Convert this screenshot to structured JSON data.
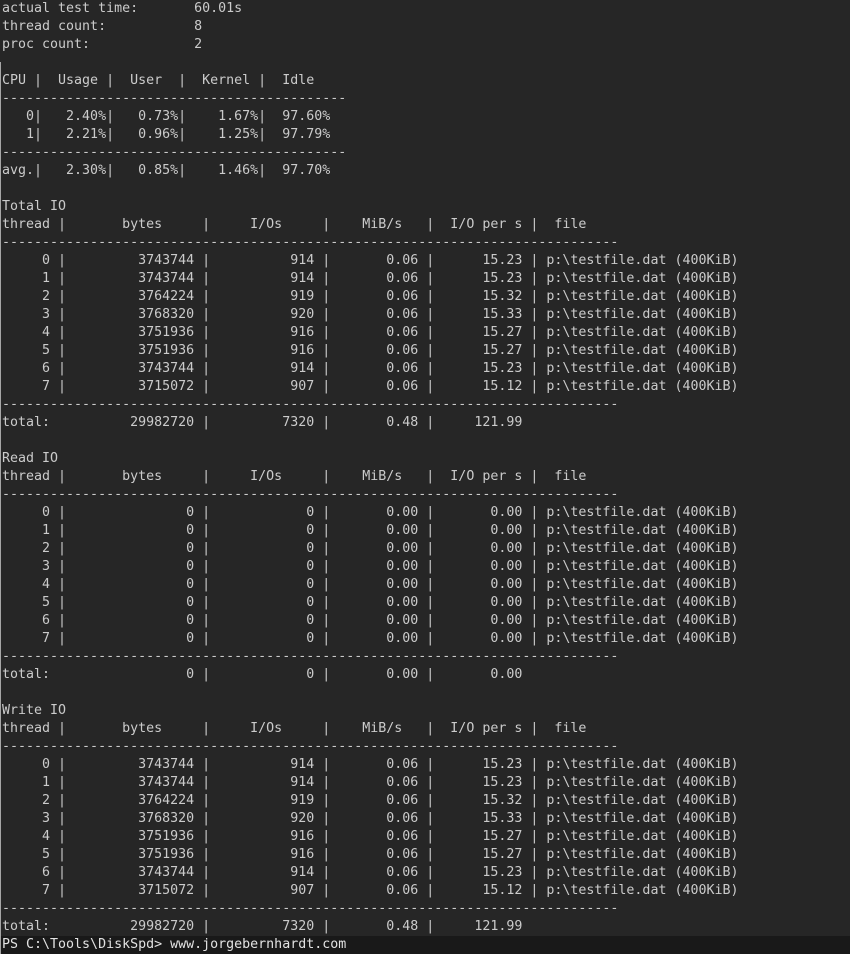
{
  "window": {
    "title": "Windows PowerShell - DiskSpd output"
  },
  "colors": {
    "background": "#262626",
    "foreground": "#cbcbcb",
    "prompt_line_background": "#191919",
    "prompt_foreground": "#e2e2e2",
    "window_edge": "#bdbdbd"
  },
  "summary": [
    {
      "label": "actual test time:",
      "value": "60.01s"
    },
    {
      "label": "thread count:",
      "value": "8"
    },
    {
      "label": "proc count:",
      "value": "2"
    }
  ],
  "cpu_table": {
    "header": "CPU |  Usage |  User  |  Kernel |  Idle",
    "separator_width": 43,
    "rows": [
      [
        "0",
        "2.40%",
        "0.73%",
        "1.67%",
        "97.60%"
      ],
      [
        "1",
        "2.21%",
        "0.96%",
        "1.25%",
        "97.79%"
      ]
    ],
    "avg_label": "avg.",
    "avg": [
      "2.30%",
      "0.85%",
      "1.46%",
      "97.70%"
    ]
  },
  "io_header": "thread |       bytes     |     I/Os     |    MiB/s   |  I/O per s |  file",
  "io_separator_width": 77,
  "file_label": "p:\\testfile.dat (400KiB)",
  "io_sections": [
    {
      "title": "Total IO",
      "rows": [
        [
          "0",
          "3743744",
          "914",
          "0.06",
          "15.23"
        ],
        [
          "1",
          "3743744",
          "914",
          "0.06",
          "15.23"
        ],
        [
          "2",
          "3764224",
          "919",
          "0.06",
          "15.32"
        ],
        [
          "3",
          "3768320",
          "920",
          "0.06",
          "15.33"
        ],
        [
          "4",
          "3751936",
          "916",
          "0.06",
          "15.27"
        ],
        [
          "5",
          "3751936",
          "916",
          "0.06",
          "15.27"
        ],
        [
          "6",
          "3743744",
          "914",
          "0.06",
          "15.23"
        ],
        [
          "7",
          "3715072",
          "907",
          "0.06",
          "15.12"
        ]
      ],
      "total_label": "total:",
      "total": [
        "29982720",
        "7320",
        "0.48",
        "121.99"
      ]
    },
    {
      "title": "Read IO",
      "rows": [
        [
          "0",
          "0",
          "0",
          "0.00",
          "0.00"
        ],
        [
          "1",
          "0",
          "0",
          "0.00",
          "0.00"
        ],
        [
          "2",
          "0",
          "0",
          "0.00",
          "0.00"
        ],
        [
          "3",
          "0",
          "0",
          "0.00",
          "0.00"
        ],
        [
          "4",
          "0",
          "0",
          "0.00",
          "0.00"
        ],
        [
          "5",
          "0",
          "0",
          "0.00",
          "0.00"
        ],
        [
          "6",
          "0",
          "0",
          "0.00",
          "0.00"
        ],
        [
          "7",
          "0",
          "0",
          "0.00",
          "0.00"
        ]
      ],
      "total_label": "total:",
      "total": [
        "0",
        "0",
        "0.00",
        "0.00"
      ]
    },
    {
      "title": "Write IO",
      "rows": [
        [
          "0",
          "3743744",
          "914",
          "0.06",
          "15.23"
        ],
        [
          "1",
          "3743744",
          "914",
          "0.06",
          "15.23"
        ],
        [
          "2",
          "3764224",
          "919",
          "0.06",
          "15.32"
        ],
        [
          "3",
          "3768320",
          "920",
          "0.06",
          "15.33"
        ],
        [
          "4",
          "3751936",
          "916",
          "0.06",
          "15.27"
        ],
        [
          "5",
          "3751936",
          "916",
          "0.06",
          "15.27"
        ],
        [
          "6",
          "3743744",
          "914",
          "0.06",
          "15.23"
        ],
        [
          "7",
          "3715072",
          "907",
          "0.06",
          "15.12"
        ]
      ],
      "total_label": "total:",
      "total": [
        "29982720",
        "7320",
        "0.48",
        "121.99"
      ]
    }
  ],
  "prompt": "PS C:\\Tools\\DiskSpd>",
  "command": "www.jorgebernhardt.com"
}
